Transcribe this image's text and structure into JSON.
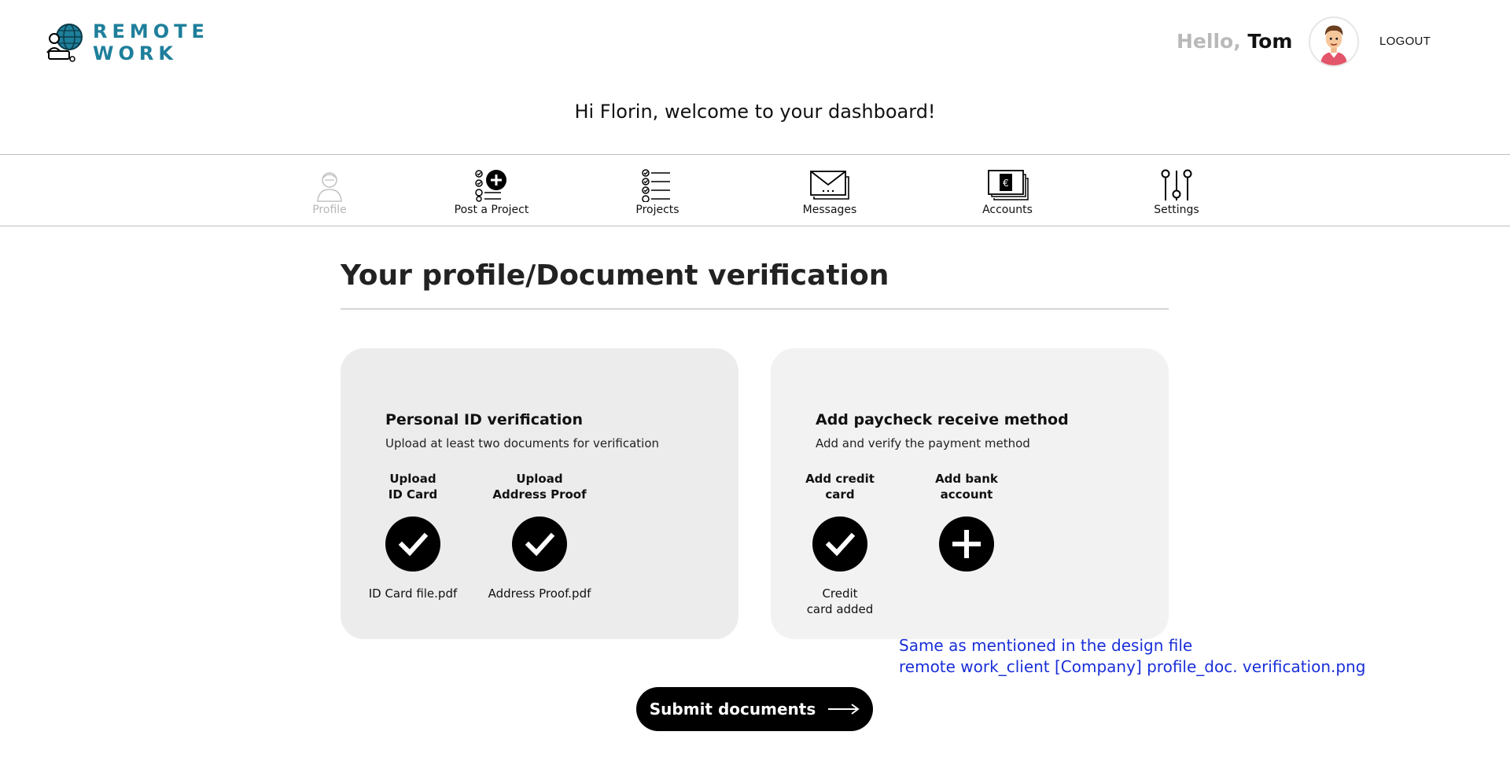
{
  "header": {
    "logo_line1": "REMOTE",
    "logo_line2": "WORK",
    "hello": "Hello,",
    "user_name": "Tom",
    "logout": "LOGOUT"
  },
  "welcome": "Hi Florin, welcome to your dashboard!",
  "nav": {
    "items": [
      {
        "label": "Profile",
        "icon": "profile-icon",
        "state": "disabled"
      },
      {
        "label": "Post a Project",
        "icon": "post-project-icon"
      },
      {
        "label": "Projects",
        "icon": "projects-checklist-icon"
      },
      {
        "label": "Messages",
        "icon": "messages-envelope-icon"
      },
      {
        "label": "Accounts",
        "icon": "accounts-banknotes-icon"
      },
      {
        "label": "Settings",
        "icon": "settings-sliders-icon"
      }
    ]
  },
  "page_title": "Your profile/Document verification",
  "cards": [
    {
      "title": "Personal ID verification",
      "subtitle": "Upload at least two documents for verification",
      "items": [
        {
          "label": "Upload\nID Card",
          "status": "check",
          "file": "ID Card file.pdf"
        },
        {
          "label": "Upload\nAddress Proof",
          "status": "check",
          "file": "Address Proof.pdf"
        }
      ]
    },
    {
      "title": "Add paycheck receive method",
      "subtitle": "Add and verify the payment method",
      "items": [
        {
          "label": "Add credit\ncard",
          "status": "check",
          "file": "Credit\ncard added"
        },
        {
          "label": "Add bank\naccount",
          "status": "add",
          "file": ""
        }
      ]
    }
  ],
  "note": {
    "line1": "Same as mentioned in the design file",
    "line2": "remote work_client [Company] profile_doc. verification.png"
  },
  "submit_label": "Submit documents",
  "colors": {
    "brand": "#1e7f9b",
    "note": "#1a2fd8",
    "card_left": "#ececec",
    "card_right": "#f2f2f2"
  }
}
